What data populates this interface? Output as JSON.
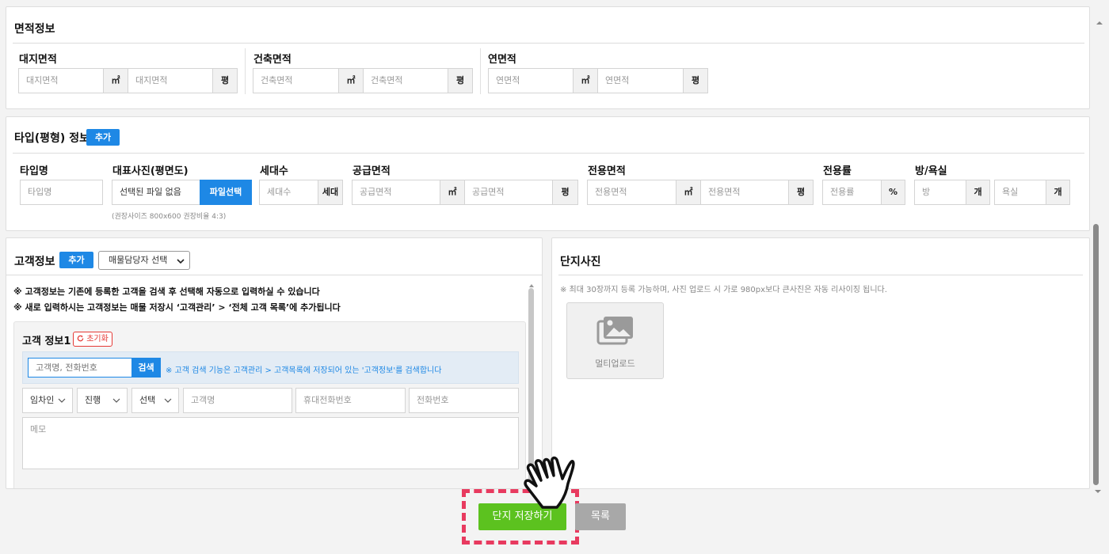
{
  "area": {
    "title": "면적정보",
    "groups": [
      {
        "label": "대지면적",
        "input1_placeholder": "대지면적",
        "unit1": "㎡",
        "input2_placeholder": "대지면적",
        "unit2": "평"
      },
      {
        "label": "건축면적",
        "input1_placeholder": "건축면적",
        "unit1": "㎡",
        "input2_placeholder": "건축면적",
        "unit2": "평"
      },
      {
        "label": "연면적",
        "input1_placeholder": "연면적",
        "unit1": "㎡",
        "input2_placeholder": "연면적",
        "unit2": "평"
      }
    ]
  },
  "type_info": {
    "title": "타입(평형) 정보",
    "add_label": "추가",
    "type_name": {
      "label": "타입명",
      "placeholder": "타입명"
    },
    "photo": {
      "label": "대표사진(평면도)",
      "file_status": "선택된 파일 없음",
      "button": "파일선택",
      "hint": "(권장사이즈 800x600 권장비율 4:3)"
    },
    "households": {
      "label": "세대수",
      "placeholder": "세대수",
      "unit": "세대"
    },
    "supply": {
      "label": "공급면적",
      "input1_placeholder": "공급면적",
      "unit1": "㎡",
      "input2_placeholder": "공급면적",
      "unit2": "평"
    },
    "exclusive": {
      "label": "전용면적",
      "input1_placeholder": "전용면적",
      "unit1": "㎡",
      "input2_placeholder": "전용면적",
      "unit2": "평"
    },
    "ratio": {
      "label": "전용률",
      "placeholder": "전용률",
      "unit": "%"
    },
    "rooms": {
      "label": "방/욕실",
      "room_placeholder": "방",
      "room_unit": "개",
      "bath_placeholder": "욕실",
      "bath_unit": "개"
    }
  },
  "customer": {
    "title": "고객정보",
    "add_label": "추가",
    "manager_select": "매물담당자 선택",
    "notice1": "※ 고객정보는 기존에 등록한 고객을 검색 후 선택해 자동으로 입력하실 수 있습니다",
    "notice2": "※ 새로 입력하시는 고객정보는 매물 저장시 ‘고객관리’ > ‘전체 고객 목록’에 추가됩니다",
    "card": {
      "title": "고객 정보1",
      "reset_label": "초기화",
      "search_placeholder": "고객명, 전화번호",
      "search_button": "검색",
      "search_hint": "※ 고객 검색 기능은 고객관리 > 고객목록에 저장되어 있는 '고객정보'를 검색합니다",
      "role_select": "임차인",
      "status_select": "진행",
      "choice_select": "선택",
      "name_placeholder": "고객명",
      "mobile_placeholder": "휴대전화번호",
      "phone_placeholder": "전화번호",
      "memo_placeholder": "메모"
    }
  },
  "complex_photo": {
    "title": "단지사진",
    "hint": "※ 최대 30장까지 등록 가능하며, 사진 업로드 시 가로 980px보다 큰사진은 자동 리사이징 됩니다.",
    "upload_label": "멀티업로드"
  },
  "actions": {
    "save_label": "단지 저장하기",
    "list_label": "목록"
  },
  "colors": {
    "accent_blue": "#1e88e5",
    "save_green": "#5cc21f",
    "highlight_red": "#e83a5f",
    "list_gray": "#a8a8a8"
  }
}
